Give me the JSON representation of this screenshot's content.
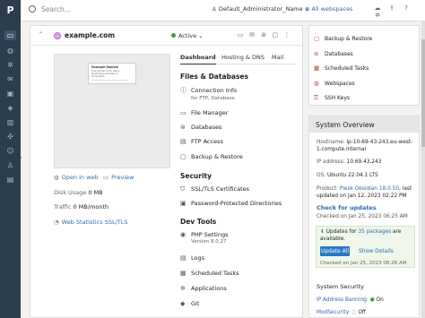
{
  "rail": {
    "logo": "P",
    "icons": [
      "monitor-icon",
      "globe-icon",
      "gear-icon",
      "mail-icon",
      "lock-icon",
      "layers-icon",
      "chart-icon",
      "puzzle-icon",
      "person-icon",
      "user-icon",
      "building-icon"
    ]
  },
  "topbar": {
    "search_placeholder": "Search...",
    "user": "Default_Administrator_Name",
    "webspaces": "All webspaces",
    "icons": [
      "cloud-icon",
      "cloud-up-icon",
      "help-icon",
      "gear-icon"
    ]
  },
  "domain": {
    "name": "example.com",
    "status": "Active",
    "preview": {
      "title": "Example Domain",
      "text": "This domain is for use in illustrative examples in documents."
    },
    "open_in_web": "Open in web",
    "preview_link": "Preview",
    "disk_usage_label": "Disk Usage",
    "disk_usage_value": "0 MB",
    "traffic_label": "Traffic",
    "traffic_value": "0 MB/month",
    "web_stats": "Web Statistics SSL/TLS"
  },
  "tabs": [
    {
      "label": "Dashboard",
      "selected": true
    },
    {
      "label": "Hosting & DNS",
      "selected": false
    },
    {
      "label": "Mail",
      "selected": false
    }
  ],
  "sections": {
    "files": {
      "title": "Files & Databases",
      "items": [
        {
          "label": "Connection Info",
          "sub": "for FTP, Database"
        },
        {
          "label": "File Manager"
        },
        {
          "label": "Databases"
        },
        {
          "label": "FTP Access"
        },
        {
          "label": "Backup & Restore"
        }
      ]
    },
    "security": {
      "title": "Security",
      "items": [
        {
          "label": "SSL/TLS Certificates"
        },
        {
          "label": "Password-Protected Directories"
        }
      ]
    },
    "devtools": {
      "title": "Dev Tools",
      "items": [
        {
          "label": "PHP Settings",
          "sub": "Version 8.0.27"
        },
        {
          "label": "Logs"
        },
        {
          "label": "Scheduled Tasks"
        },
        {
          "label": "Applications"
        },
        {
          "label": "Git"
        }
      ]
    }
  },
  "side_links": [
    "Backup & Restore",
    "Databases",
    "Scheduled Tasks",
    "Webspaces",
    "SSH Keys"
  ],
  "overview": {
    "title": "System Overview",
    "hostname_label": "Hostname:",
    "hostname_value": "ip-10-69-43-243.eu-west-1.compute.internal",
    "ip_label": "IP address:",
    "ip_value": "10.69.43.243",
    "os_label": "OS:",
    "os_value": "Ubuntu 22.04.1 LTS",
    "product_label": "Product:",
    "product_value": "Plesk Obsidian 18.0.50",
    "product_suffix": ", last updated on Jan 12, 2023 02:22 PM",
    "check_updates": "Check for updates",
    "checked_on": "Checked on Jan 25, 2023 06:25 AM",
    "updates_prefix": "Updates for",
    "updates_link": "35 packages",
    "updates_suffix": "are available.",
    "update_all": "Update All",
    "show_details": "Show Details",
    "updates_checked": "Checked on Jan 25, 2023 06:26 AM",
    "sys_security": "System Security",
    "ip_banning": "IP Address Banning:",
    "ip_banning_state": "On",
    "modsecurity": "ModSecurity:",
    "modsecurity_state": "Off"
  },
  "colors": {
    "accent": "#2a79c2",
    "rail": "#2c3e4d",
    "active": "#3c9b3c"
  }
}
